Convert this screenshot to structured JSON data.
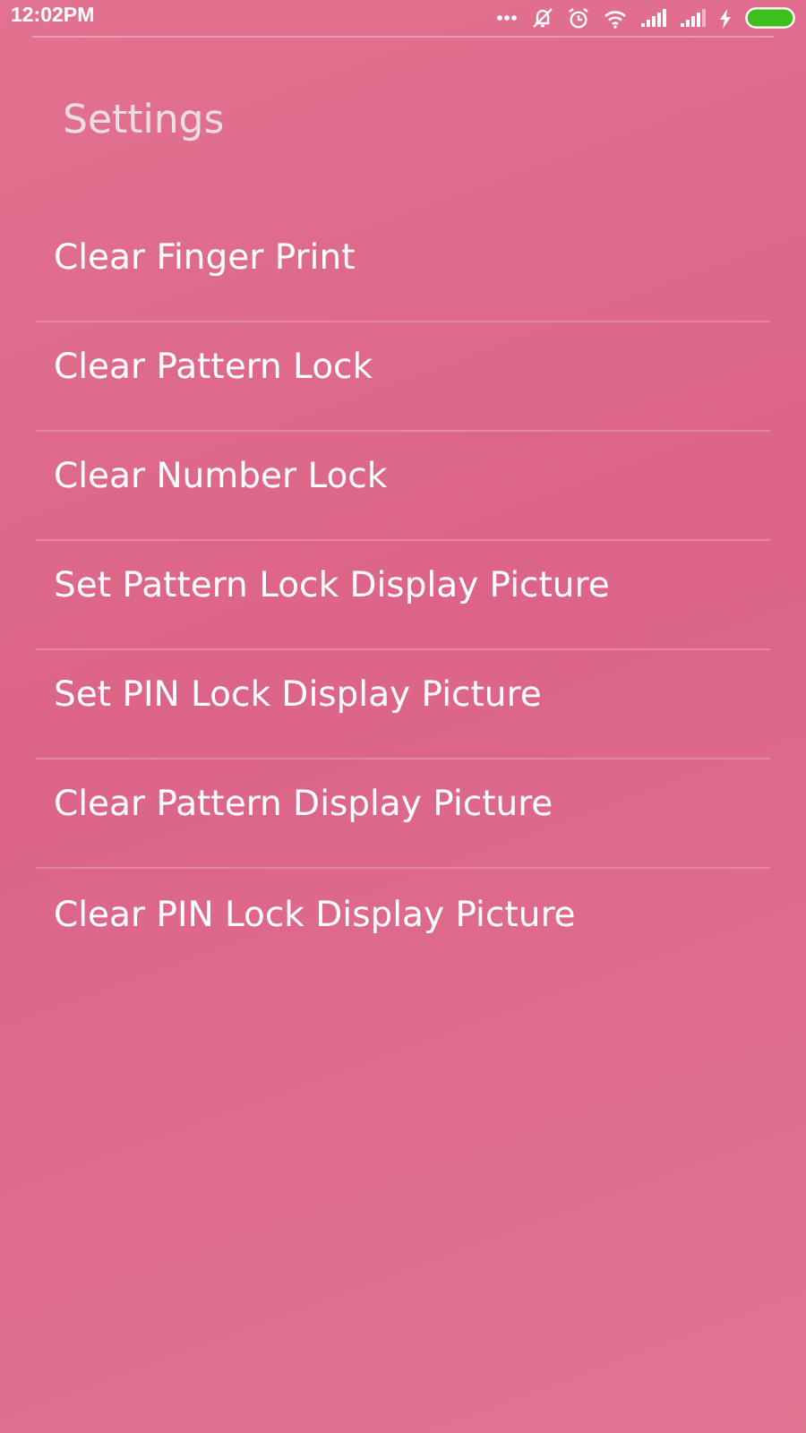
{
  "status_bar": {
    "time": "12:02PM"
  },
  "title": "Settings",
  "items": [
    {
      "label": "Clear Finger Print"
    },
    {
      "label": "Clear Pattern Lock"
    },
    {
      "label": "Clear Number Lock"
    },
    {
      "label": "Set Pattern Lock Display Picture"
    },
    {
      "label": "Set PIN Lock Display Picture"
    },
    {
      "label": "Clear Pattern Display Picture"
    },
    {
      "label": "Clear PIN Lock Display Picture"
    }
  ]
}
